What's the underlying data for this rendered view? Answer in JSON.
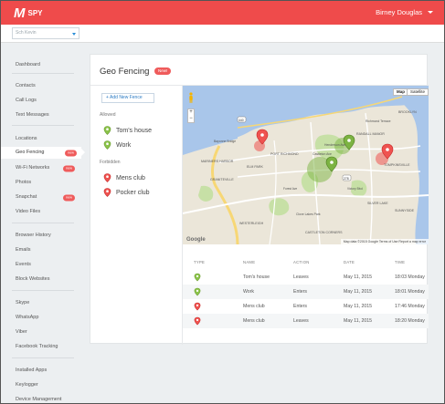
{
  "app": {
    "logo_mark": "M",
    "logo_text": "SPY",
    "user_name": "Birney Douglas"
  },
  "device_select": {
    "value": "Sch Kevin"
  },
  "colors": {
    "brand": "#ef4b4b",
    "badge": "#ef5b5b",
    "allowed": "#7cb342",
    "forbidden": "#ef5350",
    "link": "#2b7bc4"
  },
  "sidebar": {
    "items": [
      {
        "label": "Dashboard"
      },
      {
        "label": "Contacts"
      },
      {
        "label": "Call Logs"
      },
      {
        "label": "Text Messages"
      },
      {
        "label": "Locations"
      },
      {
        "label": "Geo Fencing",
        "badge": "new"
      },
      {
        "label": "Wi-Fi Networks",
        "badge": "new"
      },
      {
        "label": "Photos"
      },
      {
        "label": "Snapchat",
        "badge": "new"
      },
      {
        "label": "Video Files"
      },
      {
        "label": "Browser History"
      },
      {
        "label": "Emails"
      },
      {
        "label": "Events"
      },
      {
        "label": "Block Websites"
      },
      {
        "label": "Skype"
      },
      {
        "label": "WhatsApp"
      },
      {
        "label": "Viber"
      },
      {
        "label": "Facebook Tracking"
      },
      {
        "label": "Installed Apps"
      },
      {
        "label": "Keylogger"
      },
      {
        "label": "Device Management"
      }
    ]
  },
  "page": {
    "title": "Geo Fencing",
    "title_badge": "New!"
  },
  "fences": {
    "add_label": "+ Add New Fence",
    "allowed_label": "Allowed",
    "allowed": [
      {
        "name": "Tom's house"
      },
      {
        "name": "Work"
      }
    ],
    "forbidden_label": "Forbidden",
    "forbidden": [
      {
        "name": "Mens club"
      },
      {
        "name": "Pocker club"
      }
    ]
  },
  "map": {
    "type_map": "Map",
    "type_satellite": "Satellite",
    "zoom_in": "+",
    "zoom_out": "−",
    "google": "Google",
    "attribution": "Map data ©2015 Google   Terms of Use   Report a map error",
    "places": {
      "p1": "PORT RICHMOND",
      "p2": "MARINERS HARBOR",
      "p3": "ELM PARK",
      "p4": "Castleton Ave",
      "p5": "Henderson Ave",
      "p6": "GRANITEVILLE",
      "p7": "WESTERLEIGH",
      "p8": "Clove Lakes Park",
      "p9": "CASTLETON CORNERS",
      "p10": "SILVER LAKE",
      "p11": "SUNNYSIDE",
      "p12": "Richmond Terrace",
      "p13": "RANDALL MANOR",
      "p14": "BROOKLYN",
      "p15": "TOMPKINSVILLE",
      "p16": "Victory Blvd",
      "p17": "Forest Ave",
      "p18": "Bayonne Bridge",
      "p19": "440",
      "p20": "278"
    }
  },
  "table": {
    "headers": {
      "type": "TYPE",
      "name": "NAME",
      "action": "ACTION",
      "date": "DATE",
      "time": "TIME"
    },
    "rows": [
      {
        "kind": "allowed",
        "name": "Tom's house",
        "action": "Leaves",
        "date": "May 11, 2015",
        "time": "18:03 Monday"
      },
      {
        "kind": "allowed",
        "name": "Work",
        "action": "Enters",
        "date": "May 11, 2015",
        "time": "18:01 Monday"
      },
      {
        "kind": "forbidden",
        "name": "Mens club",
        "action": "Enters",
        "date": "May 11, 2015",
        "time": "17:46 Monday"
      },
      {
        "kind": "forbidden",
        "name": "Mens club",
        "action": "Leaves",
        "date": "May 11, 2015",
        "time": "18:20 Monday"
      }
    ]
  }
}
